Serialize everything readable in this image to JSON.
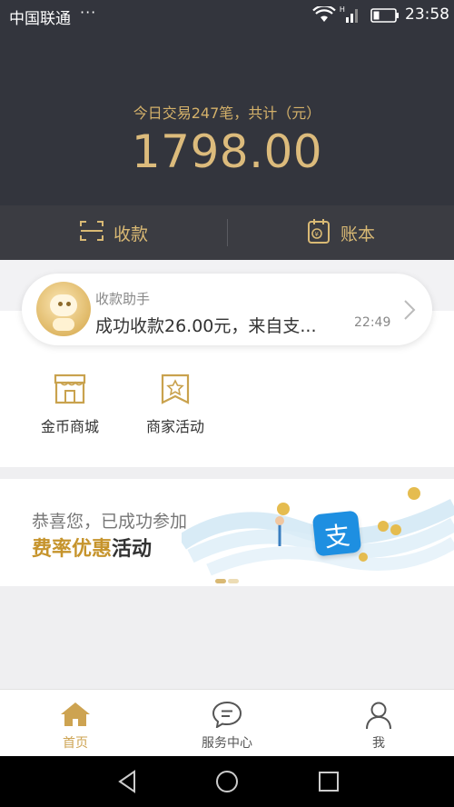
{
  "status_bar": {
    "carrier": "中国联通",
    "more": "···",
    "time": "23:58",
    "icons": [
      "wifi-icon",
      "signal-icon",
      "battery-icon"
    ]
  },
  "header": {
    "summary": "今日交易247笔，共计（元）",
    "amount": "1798.00"
  },
  "actions": {
    "collect_label": "收款",
    "ledger_label": "账本"
  },
  "notification": {
    "title": "收款助手",
    "message": "成功收款26.00元，来自支...",
    "time": "22:49"
  },
  "shortcuts": [
    {
      "label": "金币商城",
      "icon": "shop-icon"
    },
    {
      "label": "商家活动",
      "icon": "star-bookmark-icon"
    }
  ],
  "banner": {
    "line1": "恭喜您，已成功参加",
    "highlight": "费率优惠",
    "line2_rest": "活动",
    "logo_char": "支"
  },
  "tabs": [
    {
      "label": "首页",
      "icon": "home-icon",
      "active": true
    },
    {
      "label": "服务中心",
      "icon": "chat-icon",
      "active": false
    },
    {
      "label": "我",
      "icon": "user-icon",
      "active": false
    }
  ],
  "colors": {
    "accent": "#d9b974",
    "header_bg": "#33353d",
    "tab_active": "#cda351"
  }
}
